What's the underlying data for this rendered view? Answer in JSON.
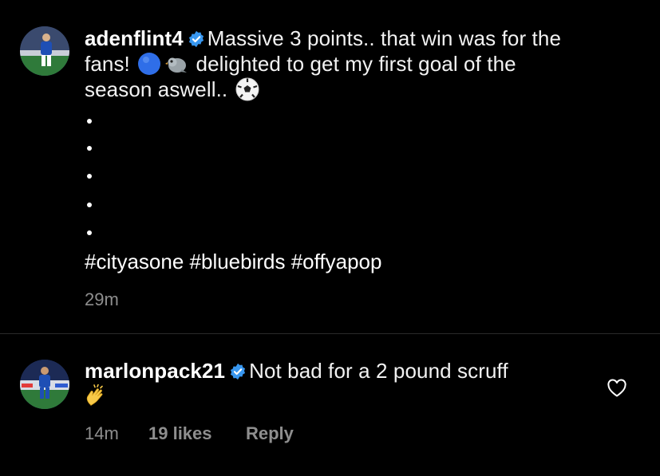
{
  "post": {
    "username": "adenflint4",
    "text_1": "Massive 3 points.. that win was for the",
    "text_2a": "fans!",
    "text_2b": "delighted to get my first goal of the",
    "text_3": "season aswell..",
    "hashtags": "#cityasone #bluebirds #offyapop",
    "time": "29m",
    "icons": [
      "verified-badge-icon",
      "blue-circle-emoji",
      "bird-emoji",
      "soccer-ball-emoji"
    ]
  },
  "comment": {
    "username": "marlonpack21",
    "text": "Not bad for a 2 pound scruff",
    "time": "14m",
    "likes": "19 likes",
    "reply": "Reply",
    "icons": [
      "verified-badge-icon",
      "clapping-hands-emoji",
      "heart-icon"
    ]
  },
  "colors": {
    "background": "#000000",
    "text": "#f2f2f2",
    "secondary": "#8e8e8e",
    "verified": "#3897f0"
  }
}
